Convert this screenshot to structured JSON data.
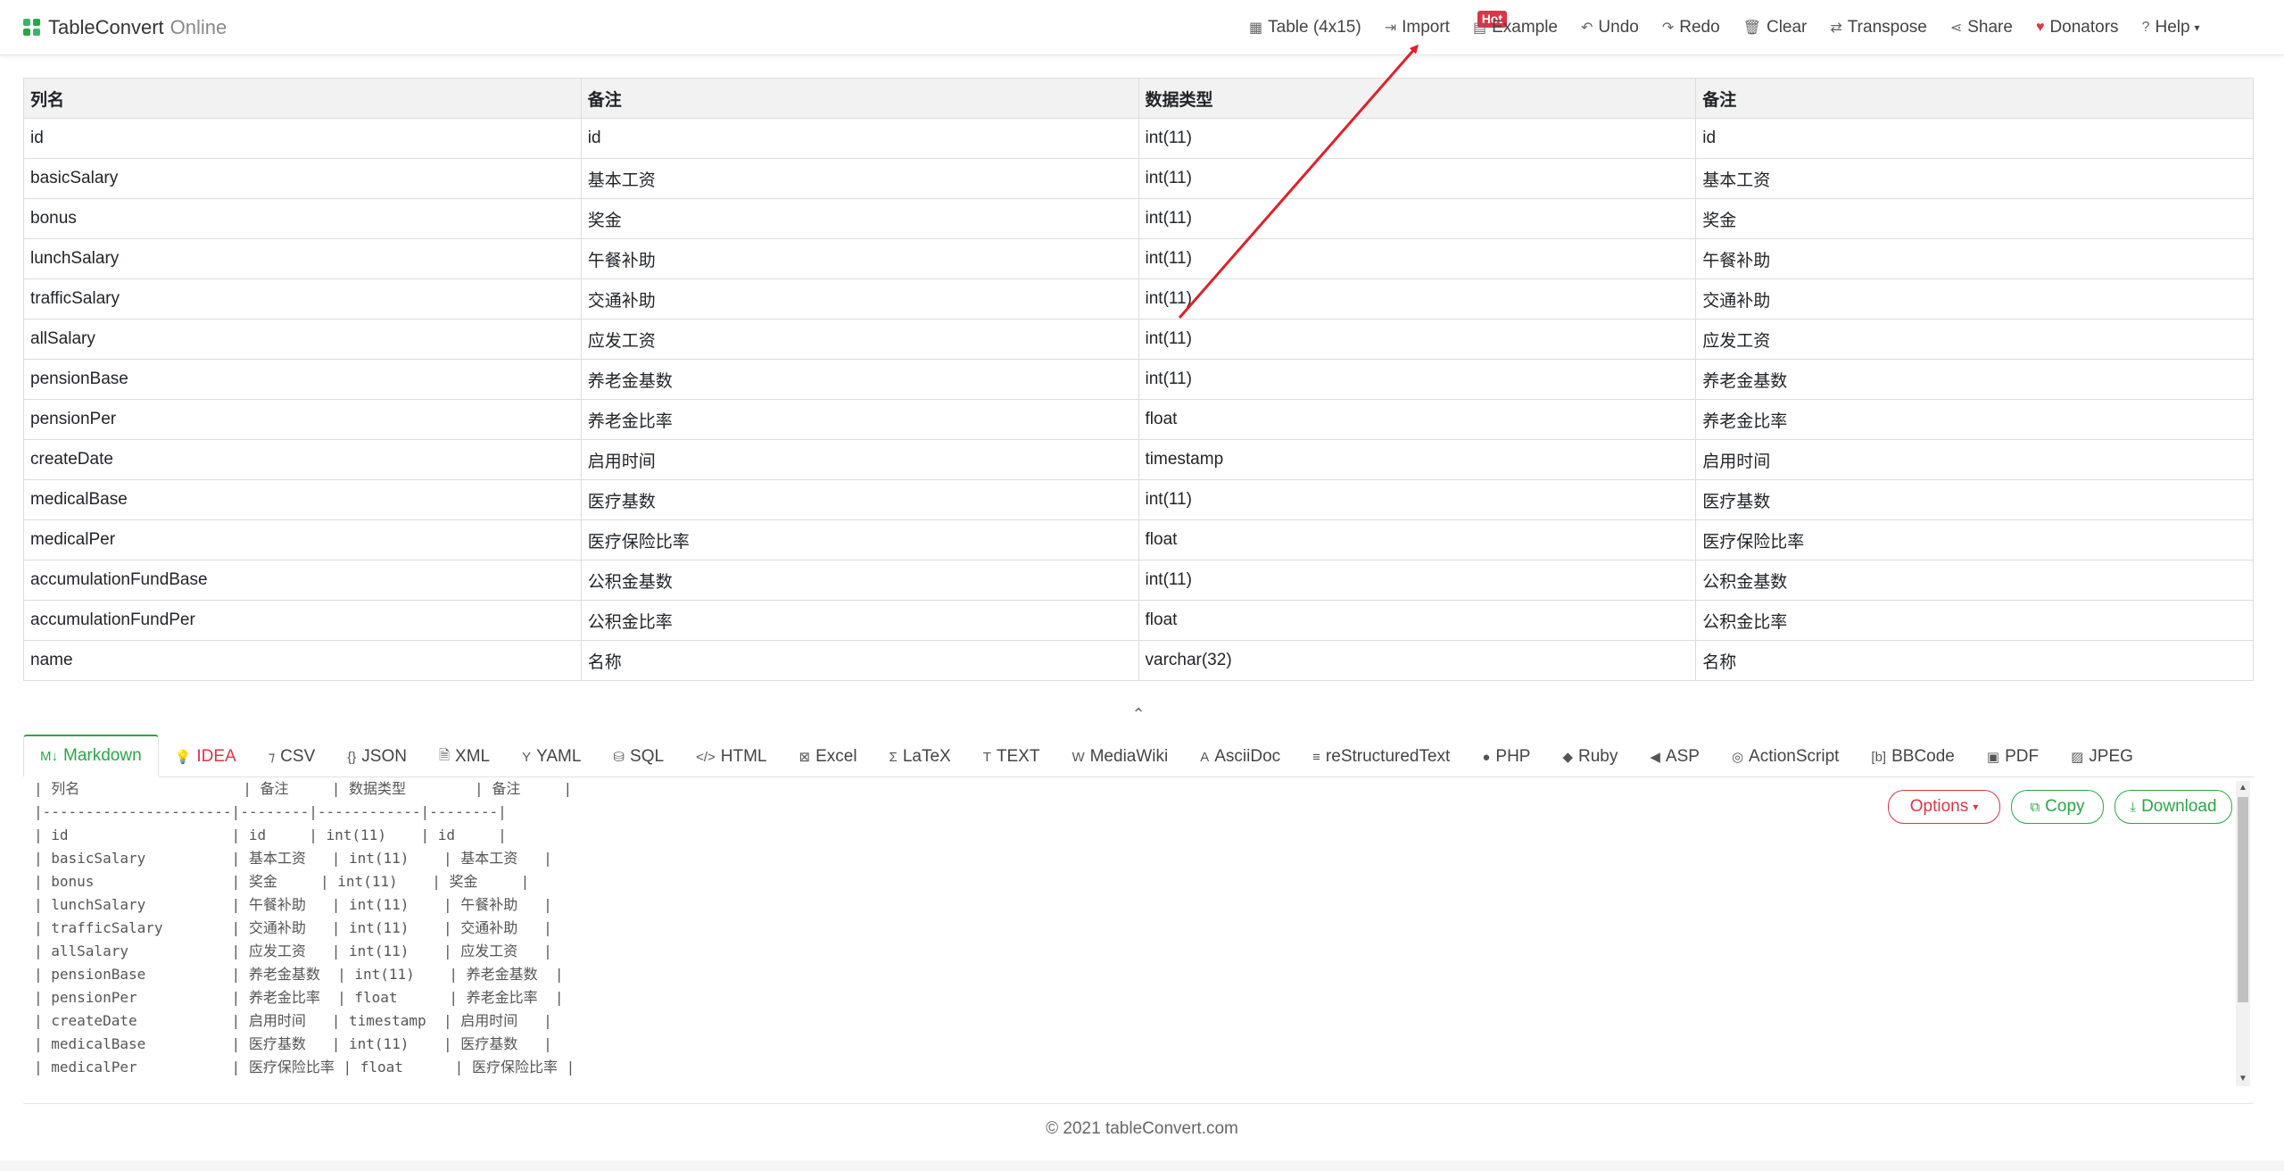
{
  "navbar": {
    "brand": "TableConvert",
    "brand_sub": "Online",
    "items": [
      {
        "icon": "table-icon",
        "glyph": "▦",
        "label": "Table (4x15)"
      },
      {
        "icon": "import-icon",
        "glyph": "⇥",
        "label": "Import",
        "badge": "Hot"
      },
      {
        "icon": "example-icon",
        "glyph": "▤",
        "label": "Example"
      },
      {
        "icon": "undo-icon",
        "glyph": "↶",
        "label": "Undo"
      },
      {
        "icon": "redo-icon",
        "glyph": "↷",
        "label": "Redo"
      },
      {
        "icon": "trash-icon",
        "glyph": "🗑",
        "label": "Clear"
      },
      {
        "icon": "transpose-icon",
        "glyph": "⇄",
        "label": "Transpose"
      },
      {
        "icon": "share-icon",
        "glyph": "⋖",
        "label": "Share"
      },
      {
        "icon": "heart-icon",
        "glyph": "♥",
        "label": "Donators"
      },
      {
        "icon": "help-icon",
        "glyph": "?",
        "label": "Help"
      }
    ]
  },
  "table": {
    "headers": [
      "列名",
      "备注",
      "数据类型",
      "备注"
    ],
    "rows": [
      [
        "id",
        "id",
        "int(11)",
        "id"
      ],
      [
        "basicSalary",
        "基本工资",
        "int(11)",
        "基本工资"
      ],
      [
        "bonus",
        "奖金",
        "int(11)",
        "奖金"
      ],
      [
        "lunchSalary",
        "午餐补助",
        "int(11)",
        "午餐补助"
      ],
      [
        "trafficSalary",
        "交通补助",
        "int(11)",
        "交通补助"
      ],
      [
        "allSalary",
        "应发工资",
        "int(11)",
        "应发工资"
      ],
      [
        "pensionBase",
        "养老金基数",
        "int(11)",
        "养老金基数"
      ],
      [
        "pensionPer",
        "养老金比率",
        "float",
        "养老金比率"
      ],
      [
        "createDate",
        "启用时间",
        "timestamp",
        "启用时间"
      ],
      [
        "medicalBase",
        "医疗基数",
        "int(11)",
        "医疗基数"
      ],
      [
        "medicalPer",
        "医疗保险比率",
        "float",
        "医疗保险比率"
      ],
      [
        "accumulationFundBase",
        "公积金基数",
        "int(11)",
        "公积金基数"
      ],
      [
        "accumulationFundPer",
        "公积金比率",
        "float",
        "公积金比率"
      ],
      [
        "name",
        "名称",
        "varchar(32)",
        "名称"
      ]
    ]
  },
  "tabs": [
    {
      "icon": "markdown-icon",
      "glyph": "M↓",
      "label": "Markdown",
      "active": true
    },
    {
      "icon": "lightbulb-icon",
      "glyph": "💡",
      "label": "IDEA",
      "idea": true
    },
    {
      "icon": "csv-icon",
      "glyph": "⁊",
      "label": "CSV"
    },
    {
      "icon": "json-icon",
      "glyph": "{}",
      "label": "JSON"
    },
    {
      "icon": "xml-icon",
      "glyph": "🗎",
      "label": "XML"
    },
    {
      "icon": "yaml-icon",
      "glyph": "Y",
      "label": "YAML"
    },
    {
      "icon": "database-icon",
      "glyph": "⛁",
      "label": "SQL"
    },
    {
      "icon": "code-icon",
      "glyph": "</>",
      "label": "HTML"
    },
    {
      "icon": "excel-icon",
      "glyph": "⊠",
      "label": "Excel"
    },
    {
      "icon": "sigma-icon",
      "glyph": "Σ",
      "label": "LaTeX"
    },
    {
      "icon": "text-icon",
      "glyph": "T",
      "label": "TEXT"
    },
    {
      "icon": "wikipedia-icon",
      "glyph": "W",
      "label": "MediaWiki"
    },
    {
      "icon": "asciidoc-icon",
      "glyph": "A",
      "label": "AsciiDoc"
    },
    {
      "icon": "rst-icon",
      "glyph": "≡",
      "label": "reStructuredText"
    },
    {
      "icon": "php-icon",
      "glyph": "●",
      "label": "PHP"
    },
    {
      "icon": "ruby-icon",
      "glyph": "◆",
      "label": "Ruby"
    },
    {
      "icon": "asp-icon",
      "glyph": "◀",
      "label": "ASP"
    },
    {
      "icon": "actionscript-icon",
      "glyph": "◎",
      "label": "ActionScript"
    },
    {
      "icon": "bbcode-icon",
      "glyph": "[b]",
      "label": "BBCode"
    },
    {
      "icon": "pdf-icon",
      "glyph": "▣",
      "label": "PDF"
    },
    {
      "icon": "image-icon",
      "glyph": "▨",
      "label": "JPEG"
    }
  ],
  "output": {
    "lines": [
      "| 列名                   | 备注     | 数据类型        | 备注     |",
      "|----------------------|--------|------------|--------|",
      "| id                   | id     | int(11)    | id     |",
      "| basicSalary          | 基本工资   | int(11)    | 基本工资   |",
      "| bonus                | 奖金     | int(11)    | 奖金     |",
      "| lunchSalary          | 午餐补助   | int(11)    | 午餐补助   |",
      "| trafficSalary        | 交通补助   | int(11)    | 交通补助   |",
      "| allSalary            | 应发工资   | int(11)    | 应发工资   |",
      "| pensionBase          | 养老金基数  | int(11)    | 养老金基数  |",
      "| pensionPer           | 养老金比率  | float      | 养老金比率  |",
      "| createDate           | 启用时间   | timestamp  | 启用时间   |",
      "| medicalBase          | 医疗基数   | int(11)    | 医疗基数   |",
      "| medicalPer           | 医疗保险比率 | float      | 医疗保险比率 |"
    ],
    "options_label": "Options",
    "copy_label": "Copy",
    "download_label": "Download"
  },
  "footer": "© 2021 tableConvert.com",
  "colors": {
    "accent": "#28a745",
    "danger": "#dc3545",
    "annotation_arrow": "#e0202a"
  }
}
